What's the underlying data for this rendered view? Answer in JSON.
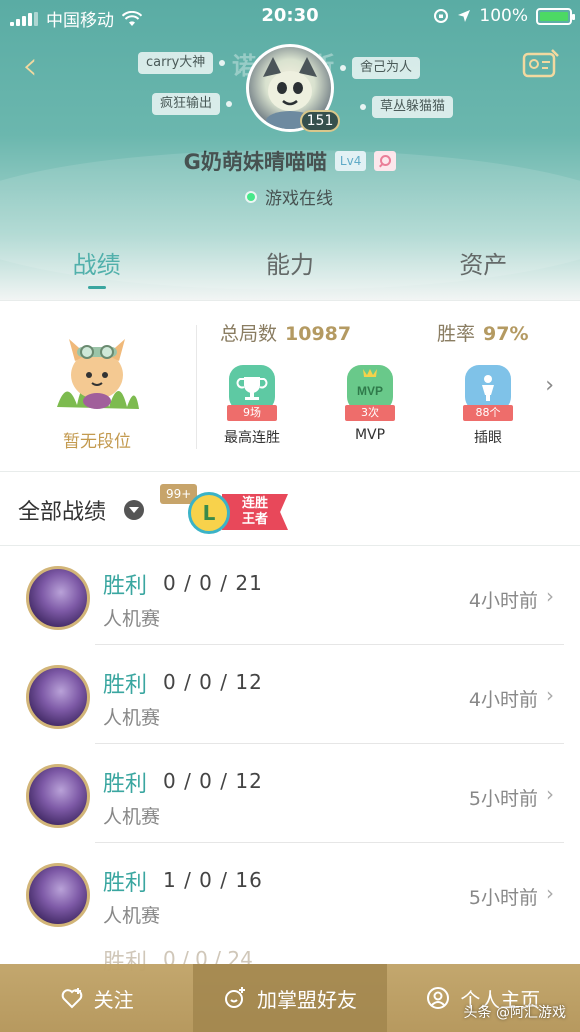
{
  "status_bar": {
    "carrier": "中国移动",
    "time": "20:30",
    "battery": "100%"
  },
  "profile": {
    "bg_name": "诺克萨斯",
    "tags": [
      "carry大神",
      "舍己为人",
      "疯狂输出",
      "草丛躲猫猫"
    ],
    "level_badge": "151",
    "username": "G奶萌妹晴喵喵",
    "lv": "Lv4",
    "status": "游戏在线"
  },
  "tabs": [
    {
      "label": "战绩",
      "active": true
    },
    {
      "label": "能力",
      "active": false
    },
    {
      "label": "资产",
      "active": false
    }
  ],
  "stats": {
    "rank_text": "暂无段位",
    "total_label": "总局数",
    "total_value": "10987",
    "winrate_label": "胜率",
    "winrate_value": "97%",
    "badges": [
      {
        "ribbon": "9场",
        "label": "最高连胜",
        "color": "#5ec9a3",
        "icon": "trophy-icon"
      },
      {
        "ribbon": "3次",
        "label": "MVP",
        "color": "#69c98a",
        "icon": "mvp-icon"
      },
      {
        "ribbon": "88个",
        "label": "插眼",
        "color": "#7fc2e8",
        "icon": "ward-icon"
      }
    ]
  },
  "records": {
    "title": "全部战绩",
    "streak_count": "99+",
    "streak_letter": "L",
    "streak_label_1": "连胜",
    "streak_label_2": "王者"
  },
  "matches": [
    {
      "result": "胜利",
      "kda": "0 / 0 / 21",
      "mode": "人机赛",
      "time": "4小时前"
    },
    {
      "result": "胜利",
      "kda": "0 / 0 / 12",
      "mode": "人机赛",
      "time": "4小时前"
    },
    {
      "result": "胜利",
      "kda": "0 / 0 / 12",
      "mode": "人机赛",
      "time": "5小时前"
    },
    {
      "result": "胜利",
      "kda": "1 / 0 / 16",
      "mode": "人机赛",
      "time": "5小时前"
    },
    {
      "result": "胜利",
      "kda": "0 / 0 / 24"
    }
  ],
  "bottom_bar": {
    "follow": "关注",
    "add_friend": "加掌盟好友",
    "home": "个人主页"
  },
  "watermark": "头条 @阿汇游戏"
}
